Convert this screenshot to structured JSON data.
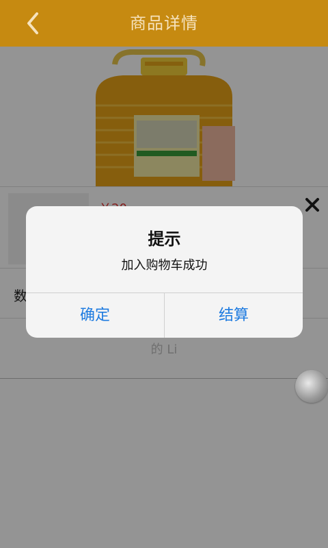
{
  "header": {
    "title": "商品详情",
    "back_icon": "chevron-left-icon"
  },
  "product": {
    "price": "￥20",
    "quantity_label": "数",
    "faded_label": "的 Li"
  },
  "dialog": {
    "title": "提示",
    "message": "加入购物车成功",
    "confirm_label": "确定",
    "checkout_label": "结算"
  },
  "colors": {
    "header_bg": "#c68a11",
    "accent_blue": "#1e7be0",
    "price_red": "#e33333"
  }
}
